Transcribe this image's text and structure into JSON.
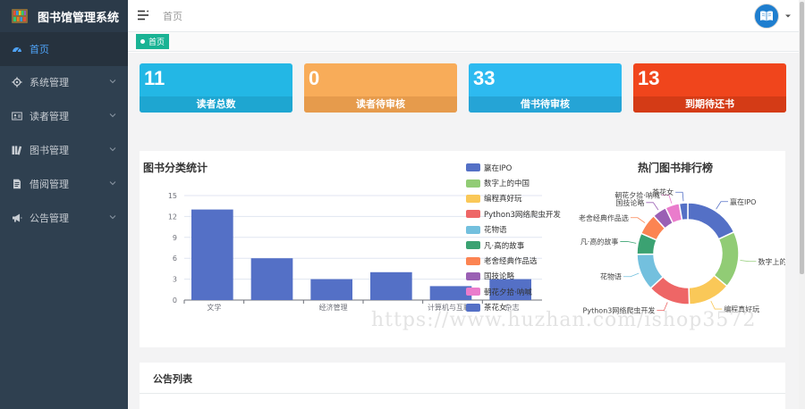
{
  "app": {
    "title": "图书馆管理系统"
  },
  "sidebar": {
    "items": [
      {
        "label": "首页",
        "icon": "dashboard-icon",
        "active": true
      },
      {
        "label": "系统管理",
        "icon": "gear-icon"
      },
      {
        "label": "读者管理",
        "icon": "id-card-icon"
      },
      {
        "label": "图书管理",
        "icon": "books-icon"
      },
      {
        "label": "借阅管理",
        "icon": "document-icon"
      },
      {
        "label": "公告管理",
        "icon": "megaphone-icon"
      }
    ]
  },
  "header": {
    "home": "首页"
  },
  "tabs": [
    {
      "label": "首页"
    }
  ],
  "stats": [
    {
      "value": "11",
      "label": "读者总数",
      "color": "#23b7e5",
      "band": "#1ea6d1"
    },
    {
      "value": "0",
      "label": "读者待审核",
      "color": "#f8ac59",
      "band": "#e69b4c"
    },
    {
      "value": "33",
      "label": "借书待审核",
      "color": "#2dbaf0",
      "band": "#25a4d6"
    },
    {
      "value": "13",
      "label": "到期待还书",
      "color": "#f0451c",
      "band": "#d43b16"
    }
  ],
  "chart_data": [
    {
      "type": "bar",
      "title": "图书分类统计",
      "categories": [
        "文学",
        "",
        "经济管理",
        "",
        "计算机与互联网",
        "杂志"
      ],
      "values": [
        13,
        6,
        3,
        4,
        2,
        3
      ],
      "ylim": [
        0,
        15
      ],
      "yticks": [
        0,
        3,
        6,
        9,
        12,
        15
      ],
      "color": "#5470c6"
    },
    {
      "type": "pie",
      "title": "热门图书排行榜",
      "donut": true,
      "labels": [
        "赢在IPO",
        "数字上的中国",
        "编程真好玩",
        "Python3网络爬虫开发",
        "花物语",
        "凡·高的故事",
        "老舍经典作品选",
        "国技论略",
        "朝花夕拾·呐喊",
        "茶花女"
      ],
      "values": [
        4,
        4,
        3,
        3,
        2.6,
        1.5,
        1.5,
        1,
        1,
        0.6
      ],
      "colors": [
        "#5470c6",
        "#91cc75",
        "#fac858",
        "#ee6666",
        "#73c0de",
        "#3ba272",
        "#fc8452",
        "#9a60b4",
        "#ea7ccc",
        "#5470c6"
      ],
      "pie_labels": [
        "赢在IPO",
        "数字上的中",
        "编程真好玩",
        "Python3网络爬虫开发",
        "花物语",
        "凡·高的故事",
        "老舍经典作品选",
        "国技论略",
        "朝花夕拾·呐喊",
        "茶花女"
      ]
    }
  ],
  "watermark": "https://www.huzhan.com/ishop3572",
  "notice": {
    "title": "公告列表"
  }
}
